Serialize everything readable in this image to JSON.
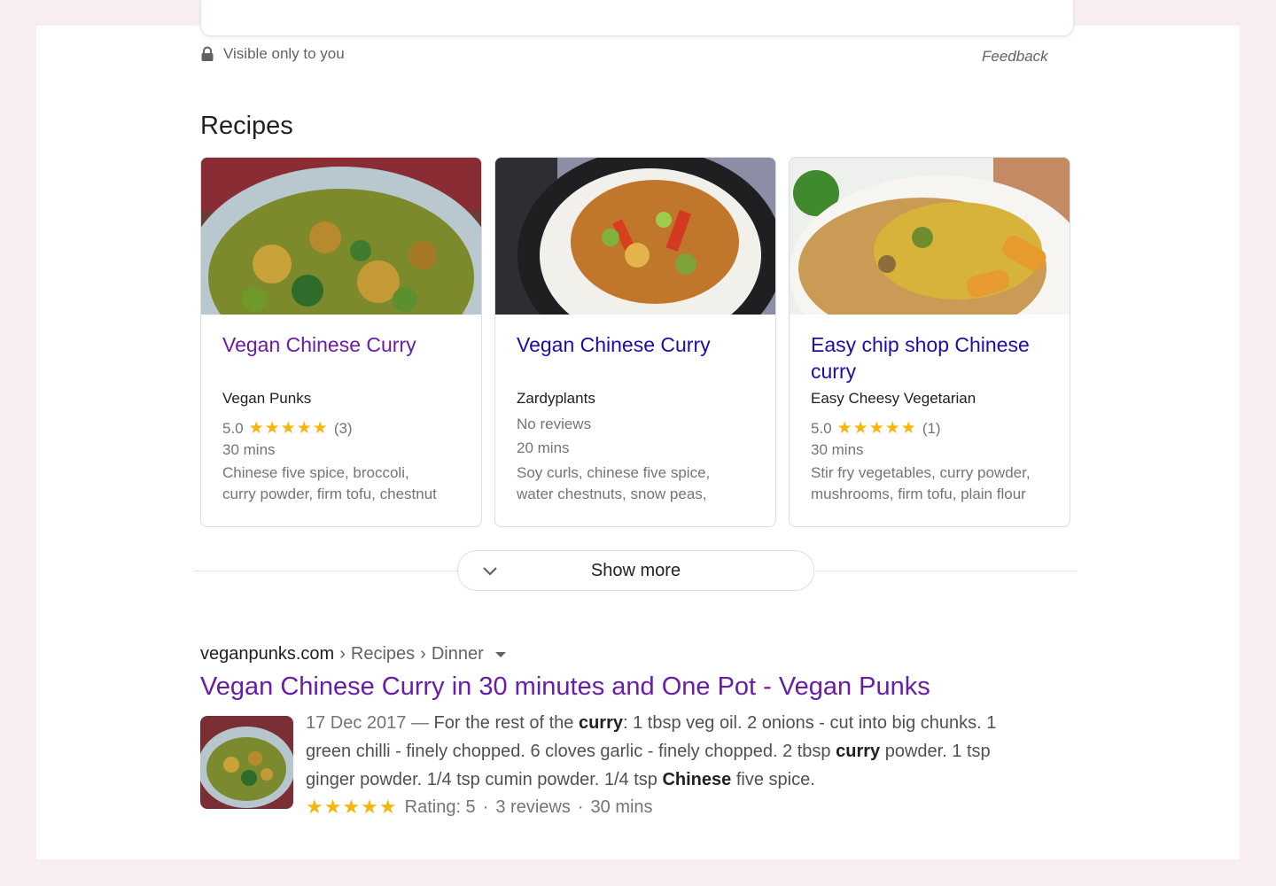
{
  "top_bar": {
    "visible_label": "Visible only to you",
    "feedback_label": "Feedback"
  },
  "recipes": {
    "heading": "Recipes",
    "cards": [
      {
        "title": "Vegan Chinese Curry",
        "source": "Vegan Punks",
        "rating": "5.0",
        "stars": "★★★★★",
        "reviews": "(3)",
        "time": "30 mins",
        "ingredients_line1": "Chinese five spice, broccoli,",
        "ingredients_line2": "curry powder, firm tofu, chestnut"
      },
      {
        "title": "Vegan Chinese Curry",
        "source": "Zardyplants",
        "reviews_text": "No reviews",
        "time": "20 mins",
        "ingredients_line1": "Soy curls, chinese five spice,",
        "ingredients_line2": "water chestnuts, snow peas,"
      },
      {
        "title": "Easy chip shop Chinese curry",
        "source": "Easy Cheesy Vegetarian",
        "rating": "5.0",
        "stars": "★★★★★",
        "reviews": "(1)",
        "time": "30 mins",
        "ingredients_line1": "Stir fry vegetables, curry powder,",
        "ingredients_line2": "mushrooms, firm tofu, plain flour"
      }
    ],
    "show_more_label": "Show more"
  },
  "result": {
    "breadcrumb_domain": "veganpunks.com",
    "breadcrumb_sep": "›",
    "breadcrumb_1": "Recipes",
    "breadcrumb_2": "Dinner",
    "title": "Vegan Chinese Curry in 30 minutes and One Pot - Vegan Punks",
    "date": "17 Dec 2017",
    "dash": " — ",
    "s1": "For the rest of the ",
    "s1b": "curry",
    "s2": ": 1 tbsp veg oil. 2 onions - cut into big chunks. 1 green chilli - finely chopped. 6 cloves garlic - finely chopped. 2 tbsp ",
    "s2b": "curry",
    "s3": " powder. 1 tsp ginger powder. 1/4 tsp cumin powder. 1/4 tsp ",
    "s3b": "Chinese",
    "s4": " five spice.",
    "stars": "★★★★★",
    "rating_text": "Rating: 5",
    "dot": "·",
    "reviews_text": "3 reviews",
    "time": "30 mins"
  },
  "colors": {
    "visited_link": "#681da8",
    "link": "#1a0dab",
    "star": "#f5b50a",
    "muted": "#70757a"
  },
  "icons": [
    "lock-icon",
    "chevron-down-icon",
    "caret-down-icon",
    "star-icon"
  ]
}
